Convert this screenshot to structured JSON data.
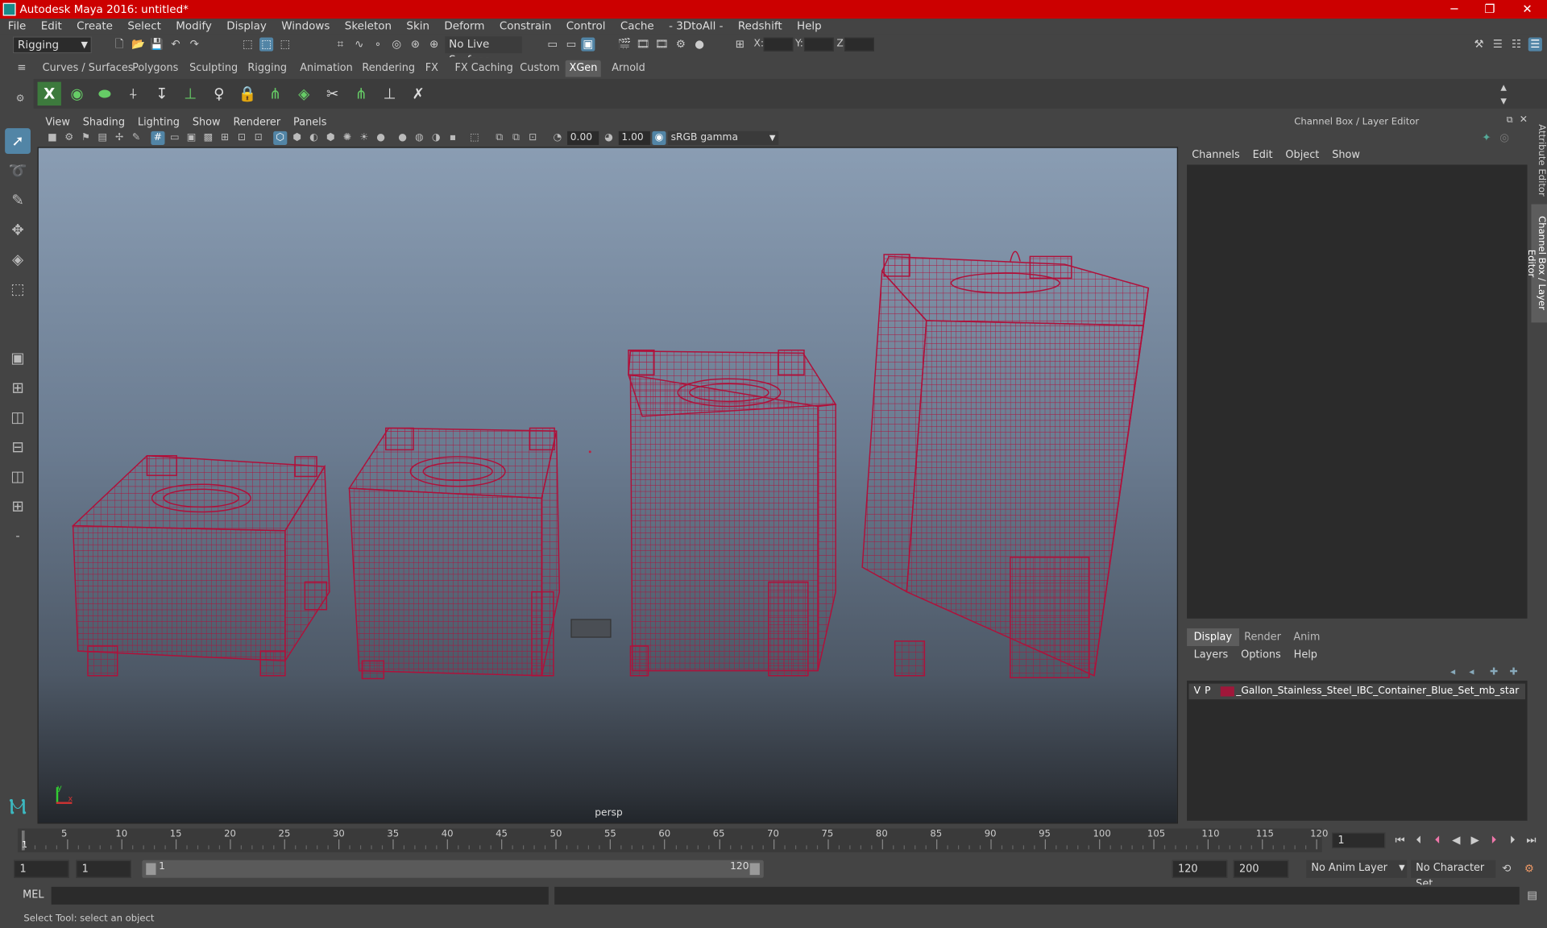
{
  "window": {
    "title": "Autodesk Maya 2016: untitled*",
    "buttons": {
      "minimize": "─",
      "restore": "❐",
      "close": "✕"
    }
  },
  "menubar": [
    "File",
    "Edit",
    "Create",
    "Select",
    "Modify",
    "Display",
    "Windows",
    "Skeleton",
    "Skin",
    "Deform",
    "Constrain",
    "Control",
    "Cache",
    "- 3DtoAll -",
    "Redshift",
    "Help"
  ],
  "statusline": {
    "menuset": "Rigging",
    "live_surface": "No Live Surface",
    "x_label": "X:",
    "y_label": "Y:",
    "z_label": "Z:"
  },
  "shelf_tabs": [
    "Curves / Surfaces",
    "Polygons",
    "Sculpting",
    "Rigging",
    "Animation",
    "Rendering",
    "FX",
    "FX Caching",
    "Custom",
    "XGen",
    "Arnold"
  ],
  "active_shelf": "XGen",
  "viewport": {
    "menu": [
      "View",
      "Shading",
      "Lighting",
      "Show",
      "Renderer",
      "Panels"
    ],
    "exposure": "0.00",
    "gamma": "1.00",
    "color_space": "sRGB gamma",
    "camera_label": "persp",
    "axis_x": "x",
    "axis_y": "y"
  },
  "channel_box": {
    "title": "Channel Box / Layer Editor",
    "menu": [
      "Channels",
      "Edit",
      "Object",
      "Show"
    ],
    "layer_tabs": [
      "Display",
      "Render",
      "Anim"
    ],
    "active_layer_tab": "Display",
    "layer_menu": [
      "Layers",
      "Options",
      "Help"
    ],
    "layer": {
      "v": "V",
      "p": "P",
      "name": "_Gallon_Stainless_Steel_IBC_Container_Blue_Set_mb_star",
      "color": "#a0173a"
    }
  },
  "side_tabs": [
    "Attribute Editor",
    "Channel Box / Layer Editor"
  ],
  "timeline": {
    "ticks": [
      1,
      5,
      10,
      15,
      20,
      25,
      30,
      35,
      40,
      45,
      50,
      55,
      60,
      65,
      70,
      75,
      80,
      85,
      90,
      95,
      100,
      105,
      110,
      115,
      120
    ],
    "current_frame": "1",
    "current_frame_field": "1"
  },
  "range": {
    "start": "1",
    "playback_start": "1",
    "slider_start": "1",
    "slider_end": "120",
    "playback_end": "120",
    "end": "200",
    "anim_layer": "No Anim Layer",
    "character_set": "No Character Set"
  },
  "cmdline": {
    "label": "MEL"
  },
  "helpline": {
    "text": "Select Tool: select an object"
  },
  "colors": {
    "titlebar": "#cc0000",
    "wireframe": "#b0103a",
    "accent": "#5285a6"
  }
}
